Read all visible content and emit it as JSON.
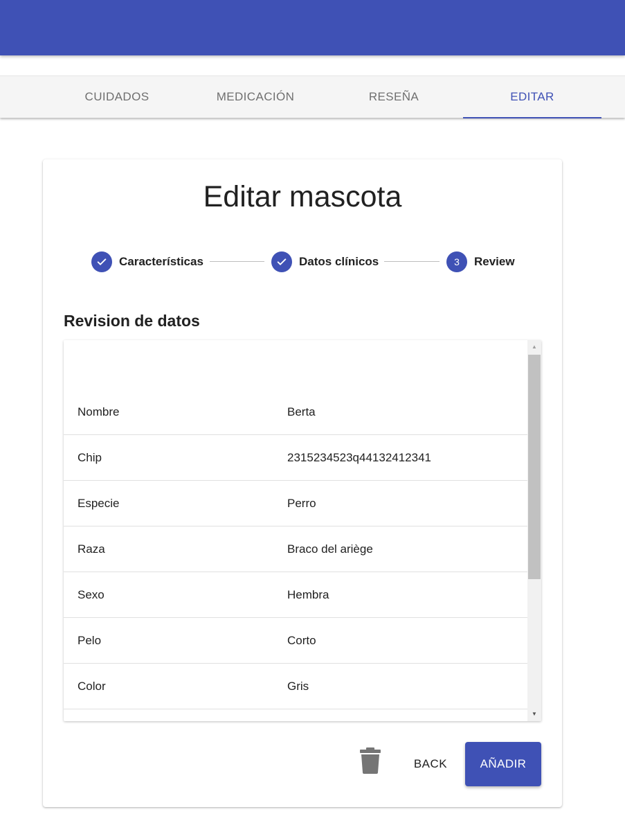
{
  "tabs": [
    {
      "label": "CUIDADOS",
      "active": false
    },
    {
      "label": "MEDICACIÓN",
      "active": false
    },
    {
      "label": "RESEÑA",
      "active": false
    },
    {
      "label": "EDITAR",
      "active": true
    }
  ],
  "card": {
    "title": "Editar mascota",
    "stepper": {
      "steps": [
        {
          "label": "Características",
          "state": "done",
          "icon": "check-icon"
        },
        {
          "label": "Datos clínicos",
          "state": "done",
          "icon": "check-icon"
        },
        {
          "label": "Review",
          "state": "active",
          "number": "3"
        }
      ]
    },
    "section_title": "Revision de datos",
    "review_rows": [
      {
        "key": "Nombre",
        "value": "Berta"
      },
      {
        "key": "Chip",
        "value": "2315234523q44132412341"
      },
      {
        "key": "Especie",
        "value": "Perro"
      },
      {
        "key": "Raza",
        "value": "Braco del ariège"
      },
      {
        "key": "Sexo",
        "value": "Hembra"
      },
      {
        "key": "Pelo",
        "value": "Corto"
      },
      {
        "key": "Color",
        "value": "Gris"
      }
    ],
    "actions": {
      "delete_icon": "trash-icon",
      "back_label": "BACK",
      "add_label": "AÑADIR"
    }
  },
  "colors": {
    "primary": "#3f51b5",
    "tab_inactive": "#6f6f6f"
  }
}
